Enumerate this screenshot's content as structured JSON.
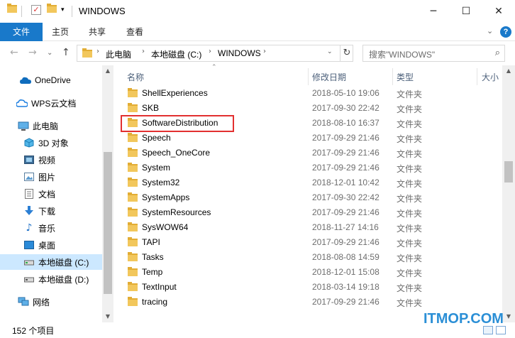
{
  "window": {
    "title": "WINDOWS",
    "minimize": "─",
    "maximize": "☐",
    "close": "✕"
  },
  "ribbon": {
    "tabs": [
      {
        "label": "文件"
      },
      {
        "label": "主页"
      },
      {
        "label": "共享"
      },
      {
        "label": "查看"
      }
    ],
    "expand": "⌄",
    "help": "?"
  },
  "nav_buttons": {
    "back": "←",
    "forward": "→",
    "recent": "⌄",
    "up": "↑"
  },
  "address": {
    "crumbs": [
      "此电脑",
      "本地磁盘 (C:)",
      "WINDOWS"
    ],
    "separator": "›",
    "dropdown": "⌄",
    "refresh": "↻"
  },
  "search": {
    "placeholder": "搜索\"WINDOWS\"",
    "icon": "search-icon"
  },
  "navpane": {
    "items": [
      {
        "label": "OneDrive",
        "icon": "cloud-icon"
      },
      {
        "label": "WPS云文档",
        "icon": "wps-cloud-icon"
      },
      {
        "label": "此电脑",
        "icon": "computer-icon"
      },
      {
        "label": "3D 对象",
        "icon": "cube-icon"
      },
      {
        "label": "视频",
        "icon": "video-icon"
      },
      {
        "label": "图片",
        "icon": "picture-icon"
      },
      {
        "label": "文档",
        "icon": "document-icon"
      },
      {
        "label": "下载",
        "icon": "download-icon"
      },
      {
        "label": "音乐",
        "icon": "music-icon"
      },
      {
        "label": "桌面",
        "icon": "desktop-icon"
      },
      {
        "label": "本地磁盘 (C:)",
        "icon": "drive-icon",
        "selected": true
      },
      {
        "label": "本地磁盘 (D:)",
        "icon": "drive-icon"
      },
      {
        "label": "网络",
        "icon": "network-icon"
      }
    ]
  },
  "columns": {
    "name": "名称",
    "date": "修改日期",
    "type": "类型",
    "size": "大小"
  },
  "files": [
    {
      "name": "ShellExperiences",
      "date": "2018-05-10 19:06",
      "type": "文件夹"
    },
    {
      "name": "SKB",
      "date": "2017-09-30 22:42",
      "type": "文件夹"
    },
    {
      "name": "SoftwareDistribution",
      "date": "2018-08-10 16:37",
      "type": "文件夹"
    },
    {
      "name": "Speech",
      "date": "2017-09-29 21:46",
      "type": "文件夹"
    },
    {
      "name": "Speech_OneCore",
      "date": "2017-09-29 21:46",
      "type": "文件夹"
    },
    {
      "name": "System",
      "date": "2017-09-29 21:46",
      "type": "文件夹"
    },
    {
      "name": "System32",
      "date": "2018-12-01 10:42",
      "type": "文件夹"
    },
    {
      "name": "SystemApps",
      "date": "2017-09-30 22:42",
      "type": "文件夹"
    },
    {
      "name": "SystemResources",
      "date": "2017-09-29 21:46",
      "type": "文件夹"
    },
    {
      "name": "SysWOW64",
      "date": "2018-11-27 14:16",
      "type": "文件夹"
    },
    {
      "name": "TAPI",
      "date": "2017-09-29 21:46",
      "type": "文件夹"
    },
    {
      "name": "Tasks",
      "date": "2018-08-08 14:59",
      "type": "文件夹"
    },
    {
      "name": "Temp",
      "date": "2018-12-01 15:08",
      "type": "文件夹"
    },
    {
      "name": "TextInput",
      "date": "2018-03-14 19:18",
      "type": "文件夹"
    },
    {
      "name": "tracing",
      "date": "2017-09-29 21:46",
      "type": "文件夹"
    }
  ],
  "status": {
    "item_count": "152 个项目"
  },
  "watermark": "ITMOP.COM",
  "colors": {
    "accent": "#1979ca",
    "selected": "#cce8ff",
    "highlight_box": "#e23030",
    "folder": "#f2c75c"
  }
}
